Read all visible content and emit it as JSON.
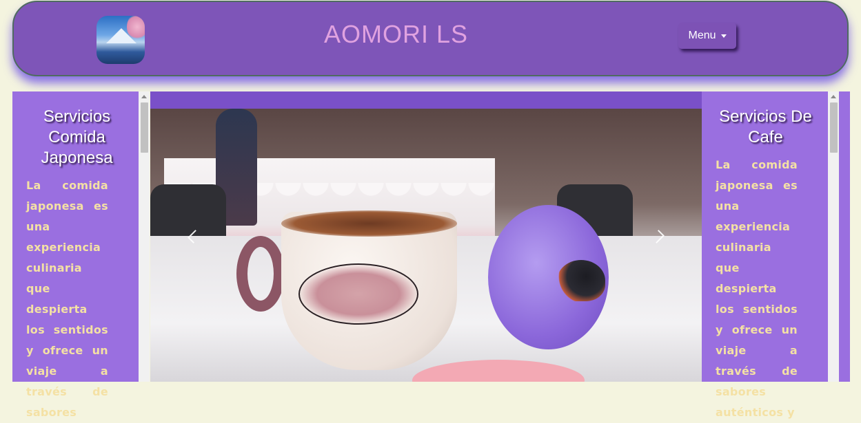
{
  "header": {
    "title": "AOMORI LS",
    "menu_label": "Menu",
    "logo_icon": "mount-fuji-logo"
  },
  "left_panel": {
    "heading": "Servicios Comida Japonesa",
    "text": "La comida japonesa es una experiencia culinaria que despierta los sentidos y ofrece un viaje a través de sabores"
  },
  "right_panel": {
    "heading": "Servicios De Cafe",
    "text": "La comida japonesa es una experiencia culinaria que despierta los sentidos y ofrece un viaje a través de sabores auténticos y"
  },
  "carousel": {
    "prev_icon": "chevron-left-icon",
    "next_icon": "chevron-right-icon"
  },
  "colors": {
    "header_bg": "#7e55b8",
    "panel_bg": "#9a6fe0",
    "title_color": "#e0a2e0",
    "panel_text": "#f4e1a4",
    "page_bg": "#f4f4df"
  }
}
